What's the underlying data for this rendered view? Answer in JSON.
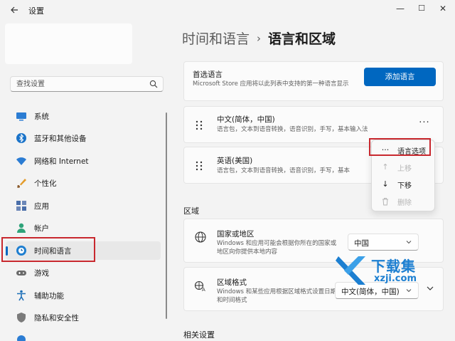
{
  "window": {
    "title": "设置",
    "back_icon": "arrow-left",
    "controls": {
      "minimize": "—",
      "maximize": "☐",
      "close": "✕"
    }
  },
  "search": {
    "placeholder": "查找设置"
  },
  "sidebar": {
    "items": [
      {
        "label": "系统",
        "icon": "monitor-icon"
      },
      {
        "label": "蓝牙和其他设备",
        "icon": "bluetooth-icon"
      },
      {
        "label": "网络和 Internet",
        "icon": "wifi-icon"
      },
      {
        "label": "个性化",
        "icon": "brush-icon"
      },
      {
        "label": "应用",
        "icon": "apps-icon"
      },
      {
        "label": "帐户",
        "icon": "person-icon"
      },
      {
        "label": "时间和语言",
        "icon": "globe-clock-icon",
        "active": true
      },
      {
        "label": "游戏",
        "icon": "gamepad-icon"
      },
      {
        "label": "辅助功能",
        "icon": "accessibility-icon"
      },
      {
        "label": "隐私和安全性",
        "icon": "shield-icon"
      }
    ]
  },
  "breadcrumb": {
    "parent": "时间和语言",
    "separator": "›",
    "current": "语言和区域"
  },
  "preferred_language": {
    "title": "首选语言",
    "description": "Microsoft Store 应用将以此列表中支持的第一种语言显示",
    "add_button": "添加语言"
  },
  "languages": [
    {
      "name": "中文(简体，中国)",
      "features": "语言包，文本到语音转换，语音识别，手写，基本输入法"
    },
    {
      "name": "英语(美国)",
      "features": "语言包，文本到语音转换，语音识别，手写，基本"
    }
  ],
  "more_icon": "···",
  "context_menu": {
    "items": [
      {
        "label": "语言选项",
        "icon": "···",
        "enabled": true,
        "highlighted": true
      },
      {
        "label": "上移",
        "icon": "↑",
        "enabled": false
      },
      {
        "label": "下移",
        "icon": "↓",
        "enabled": true
      },
      {
        "label": "删除",
        "icon": "trash-icon",
        "enabled": false
      }
    ]
  },
  "region_section": {
    "label": "区域",
    "country": {
      "title": "国家或地区",
      "description": "Windows 和应用可能会根据你所在的国家或地区向你提供本地内容",
      "value": "中国"
    },
    "format": {
      "title": "区域格式",
      "description": "Windows 和某些应用根据区域格式设置日期和时间格式",
      "value": "中文(简体，中国)"
    }
  },
  "related_section": {
    "label": "相关设置"
  },
  "watermark": {
    "main": "下载集",
    "sub": "xzji.com"
  },
  "colors": {
    "accent": "#0067c0",
    "highlight_box": "#c8282e",
    "watermark": "#1c7fd1"
  }
}
